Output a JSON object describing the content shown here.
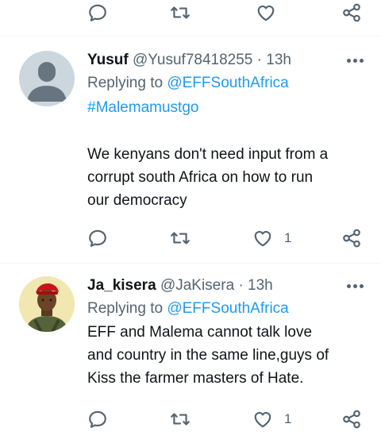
{
  "top_actions": {
    "reply_count": "",
    "retweet_count": "",
    "like_count": ""
  },
  "tweets": [
    {
      "name": "Yusuf",
      "handle": "@Yusuf78418255",
      "separator": "·",
      "time": "13h",
      "replying_to_label": "Replying to",
      "replying_to_handle": "@EFFSouthAfrica",
      "hashtag": "#Malemamustgo",
      "text_lines": [
        "We kenyans don't need input from a",
        "corrupt south Africa on how to run",
        "our democracy"
      ],
      "reply_count": "",
      "retweet_count": "",
      "like_count": "1"
    },
    {
      "name": "Ja_kisera",
      "handle": "@JaKisera",
      "separator": "·",
      "time": "13h",
      "replying_to_label": "Replying to",
      "replying_to_handle": "@EFFSouthAfrica",
      "text_lines": [
        "EFF and Malema cannot talk love",
        "and country in the same line,guys of",
        "Kiss the farmer masters of Hate."
      ],
      "reply_count": "",
      "retweet_count": "",
      "like_count": "1"
    }
  ],
  "icons": {
    "reply": "reply-icon",
    "retweet": "retweet-icon",
    "like": "heart-icon",
    "share": "share-icon",
    "more": "more-options-icon"
  },
  "colors": {
    "link": "#1d9bf0",
    "secondary": "#536471",
    "text": "#0f1419",
    "divider": "#eff3f4"
  }
}
